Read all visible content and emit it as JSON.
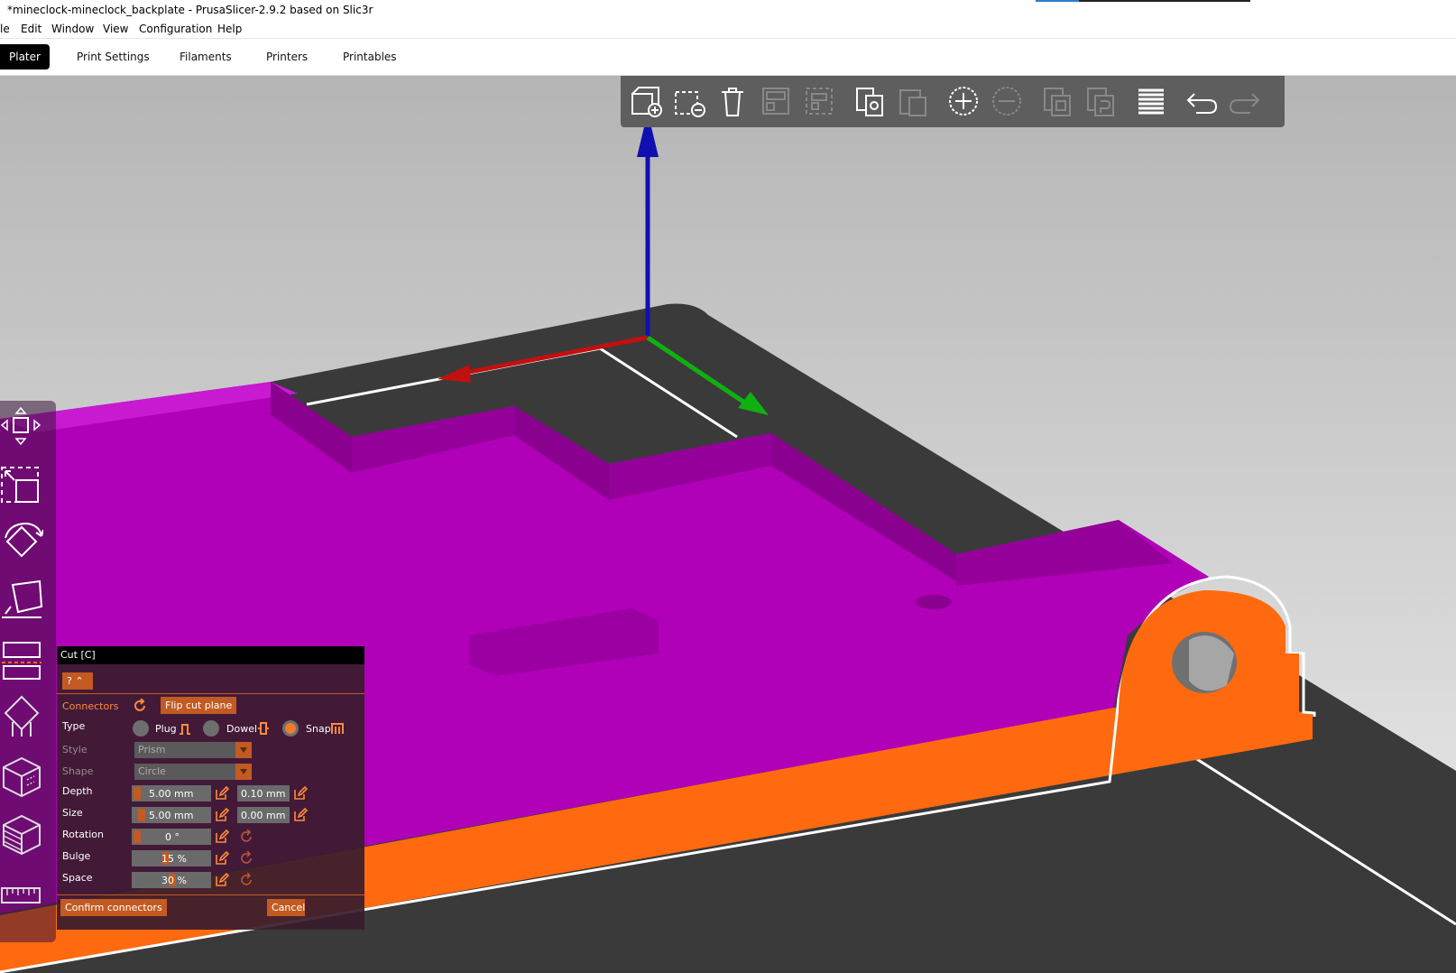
{
  "window": {
    "title": "*mineclock-mineclock_backplate - PrusaSlicer-2.9.2 based on Slic3r"
  },
  "menu": [
    "le",
    "Edit",
    "Window",
    "View",
    "Configuration",
    "Help"
  ],
  "tabs": [
    "Plater",
    "Print Settings",
    "Filaments",
    "Printers",
    "Printables"
  ],
  "colors": {
    "accent": "#c25a22",
    "part_magenta": "#b000b8",
    "part_orange": "#ff6a10",
    "bed": "#3d3d3d"
  },
  "toolbar_icons": [
    "add-icon",
    "delete-icon",
    "delete-all-icon",
    "arrange-icon",
    "arrange-selection-icon",
    "copy-icon",
    "paste-icon",
    "add-instance-icon",
    "remove-instance-icon",
    "split-objects-icon",
    "split-parts-icon",
    "layers-editing-icon",
    "undo-icon",
    "redo-icon"
  ],
  "left_tools": [
    "move-icon",
    "scale-icon",
    "rotate-icon",
    "place-on-face-icon",
    "cut-icon",
    "fdm-supports-icon",
    "seam-icon",
    "mmu-paint-icon",
    "measure-icon"
  ],
  "cut_panel": {
    "title": "Cut [C]",
    "help_label": "?",
    "connectors_label": "Connectors",
    "flip_label": "Flip cut plane",
    "type_label": "Type",
    "type_options": [
      "Plug",
      "Dowel",
      "Snap"
    ],
    "selected_type": "Snap",
    "style_label": "Style",
    "style_value": "Prism",
    "shape_label": "Shape",
    "shape_value": "Circle",
    "depth_label": "Depth",
    "depth_value": "5.00",
    "depth_unit": "mm",
    "depth_tolerance": "0.10",
    "depth_tol_unit": "mm",
    "size_label": "Size",
    "size_value": "5.00",
    "size_unit": "mm",
    "size_tolerance": "0.00",
    "size_tol_unit": "mm",
    "rotation_label": "Rotation",
    "rotation_value": "0 °",
    "bulge_label": "Bulge",
    "bulge_value": "15 %",
    "space_label": "Space",
    "space_value": "30 %",
    "confirm_label": "Confirm connectors",
    "cancel_label": "Cancel"
  }
}
